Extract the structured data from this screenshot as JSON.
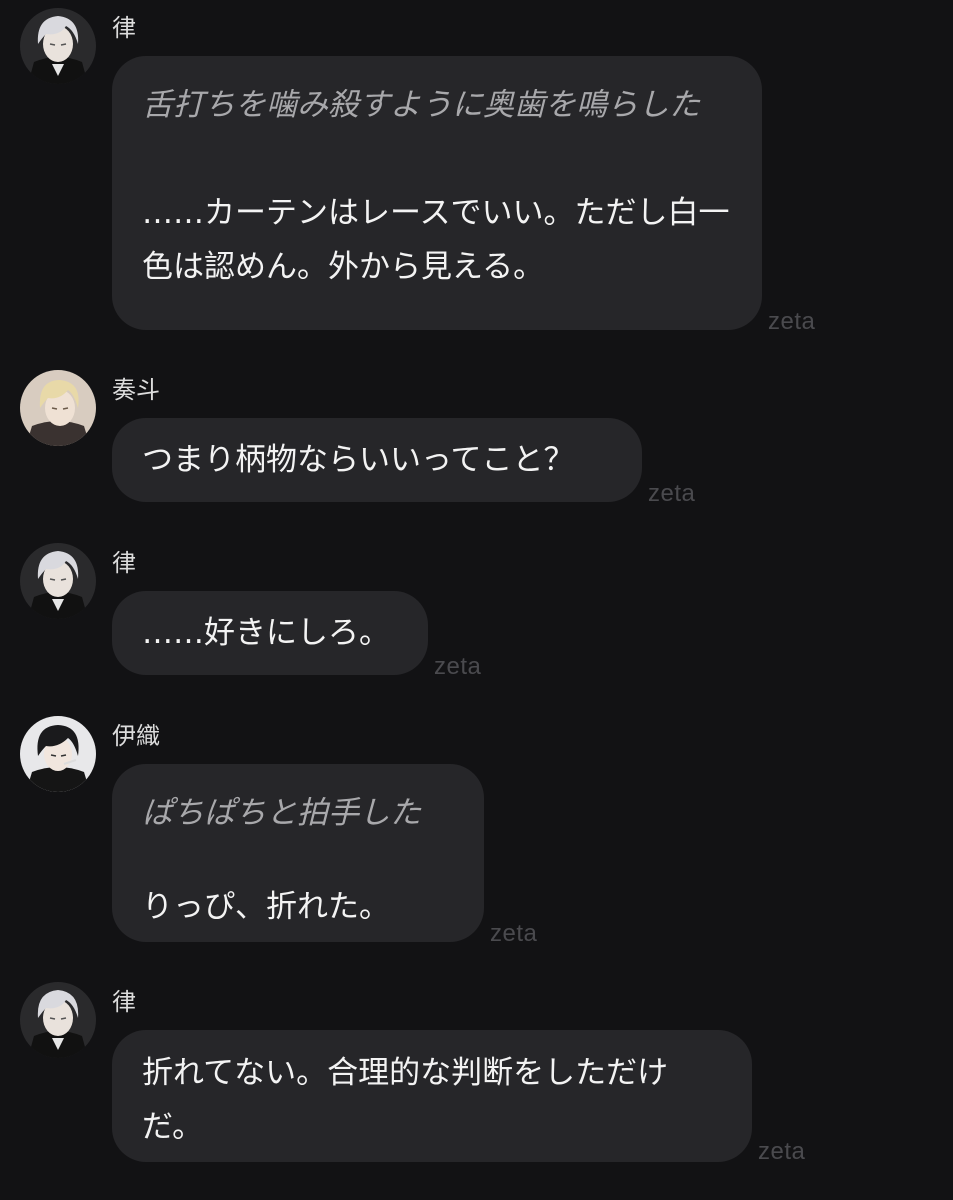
{
  "messages": [
    {
      "sender": "律",
      "avatar": "silver-hair-avatar",
      "paragraphs": [
        {
          "type": "action",
          "text": "舌打ちを噛み殺すように奥歯を鳴らした"
        },
        {
          "type": "speech",
          "text": "……カーテンはレースでいい。ただし白一色は認めん。外から見える。"
        }
      ],
      "tag": "zeta"
    },
    {
      "sender": "奏斗",
      "avatar": "blonde-hair-avatar",
      "paragraphs": [
        {
          "type": "speech",
          "text": "つまり柄物ならいいってこと？"
        }
      ],
      "tag": "zeta"
    },
    {
      "sender": "律",
      "avatar": "silver-hair-avatar",
      "paragraphs": [
        {
          "type": "speech",
          "text": "……好きにしろ。"
        }
      ],
      "tag": "zeta"
    },
    {
      "sender": "伊織",
      "avatar": "black-hair-avatar",
      "paragraphs": [
        {
          "type": "action",
          "text": "ぱちぱちと拍手した"
        },
        {
          "type": "speech",
          "text": "りっぴ、折れた。"
        }
      ],
      "tag": "zeta"
    },
    {
      "sender": "律",
      "avatar": "silver-hair-avatar",
      "paragraphs": [
        {
          "type": "speech",
          "text": "折れてない。合理的な判断をしただけだ。"
        }
      ],
      "tag": "zeta"
    }
  ]
}
